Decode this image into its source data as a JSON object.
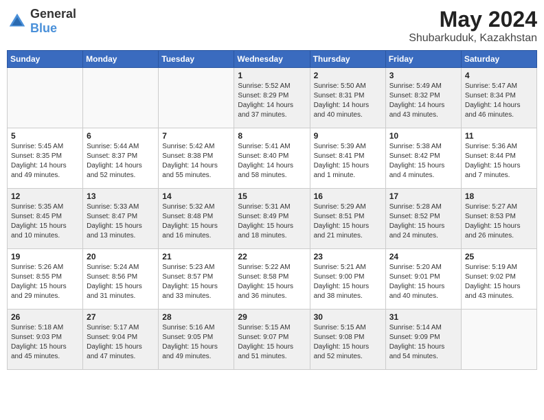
{
  "header": {
    "logo_general": "General",
    "logo_blue": "Blue",
    "month_year": "May 2024",
    "location": "Shubarkuduk, Kazakhstan"
  },
  "days_of_week": [
    "Sunday",
    "Monday",
    "Tuesday",
    "Wednesday",
    "Thursday",
    "Friday",
    "Saturday"
  ],
  "weeks": [
    [
      {
        "day": "",
        "info": ""
      },
      {
        "day": "",
        "info": ""
      },
      {
        "day": "",
        "info": ""
      },
      {
        "day": "1",
        "info": "Sunrise: 5:52 AM\nSunset: 8:29 PM\nDaylight: 14 hours\nand 37 minutes."
      },
      {
        "day": "2",
        "info": "Sunrise: 5:50 AM\nSunset: 8:31 PM\nDaylight: 14 hours\nand 40 minutes."
      },
      {
        "day": "3",
        "info": "Sunrise: 5:49 AM\nSunset: 8:32 PM\nDaylight: 14 hours\nand 43 minutes."
      },
      {
        "day": "4",
        "info": "Sunrise: 5:47 AM\nSunset: 8:34 PM\nDaylight: 14 hours\nand 46 minutes."
      }
    ],
    [
      {
        "day": "5",
        "info": "Sunrise: 5:45 AM\nSunset: 8:35 PM\nDaylight: 14 hours\nand 49 minutes."
      },
      {
        "day": "6",
        "info": "Sunrise: 5:44 AM\nSunset: 8:37 PM\nDaylight: 14 hours\nand 52 minutes."
      },
      {
        "day": "7",
        "info": "Sunrise: 5:42 AM\nSunset: 8:38 PM\nDaylight: 14 hours\nand 55 minutes."
      },
      {
        "day": "8",
        "info": "Sunrise: 5:41 AM\nSunset: 8:40 PM\nDaylight: 14 hours\nand 58 minutes."
      },
      {
        "day": "9",
        "info": "Sunrise: 5:39 AM\nSunset: 8:41 PM\nDaylight: 15 hours\nand 1 minute."
      },
      {
        "day": "10",
        "info": "Sunrise: 5:38 AM\nSunset: 8:42 PM\nDaylight: 15 hours\nand 4 minutes."
      },
      {
        "day": "11",
        "info": "Sunrise: 5:36 AM\nSunset: 8:44 PM\nDaylight: 15 hours\nand 7 minutes."
      }
    ],
    [
      {
        "day": "12",
        "info": "Sunrise: 5:35 AM\nSunset: 8:45 PM\nDaylight: 15 hours\nand 10 minutes."
      },
      {
        "day": "13",
        "info": "Sunrise: 5:33 AM\nSunset: 8:47 PM\nDaylight: 15 hours\nand 13 minutes."
      },
      {
        "day": "14",
        "info": "Sunrise: 5:32 AM\nSunset: 8:48 PM\nDaylight: 15 hours\nand 16 minutes."
      },
      {
        "day": "15",
        "info": "Sunrise: 5:31 AM\nSunset: 8:49 PM\nDaylight: 15 hours\nand 18 minutes."
      },
      {
        "day": "16",
        "info": "Sunrise: 5:29 AM\nSunset: 8:51 PM\nDaylight: 15 hours\nand 21 minutes."
      },
      {
        "day": "17",
        "info": "Sunrise: 5:28 AM\nSunset: 8:52 PM\nDaylight: 15 hours\nand 24 minutes."
      },
      {
        "day": "18",
        "info": "Sunrise: 5:27 AM\nSunset: 8:53 PM\nDaylight: 15 hours\nand 26 minutes."
      }
    ],
    [
      {
        "day": "19",
        "info": "Sunrise: 5:26 AM\nSunset: 8:55 PM\nDaylight: 15 hours\nand 29 minutes."
      },
      {
        "day": "20",
        "info": "Sunrise: 5:24 AM\nSunset: 8:56 PM\nDaylight: 15 hours\nand 31 minutes."
      },
      {
        "day": "21",
        "info": "Sunrise: 5:23 AM\nSunset: 8:57 PM\nDaylight: 15 hours\nand 33 minutes."
      },
      {
        "day": "22",
        "info": "Sunrise: 5:22 AM\nSunset: 8:58 PM\nDaylight: 15 hours\nand 36 minutes."
      },
      {
        "day": "23",
        "info": "Sunrise: 5:21 AM\nSunset: 9:00 PM\nDaylight: 15 hours\nand 38 minutes."
      },
      {
        "day": "24",
        "info": "Sunrise: 5:20 AM\nSunset: 9:01 PM\nDaylight: 15 hours\nand 40 minutes."
      },
      {
        "day": "25",
        "info": "Sunrise: 5:19 AM\nSunset: 9:02 PM\nDaylight: 15 hours\nand 43 minutes."
      }
    ],
    [
      {
        "day": "26",
        "info": "Sunrise: 5:18 AM\nSunset: 9:03 PM\nDaylight: 15 hours\nand 45 minutes."
      },
      {
        "day": "27",
        "info": "Sunrise: 5:17 AM\nSunset: 9:04 PM\nDaylight: 15 hours\nand 47 minutes."
      },
      {
        "day": "28",
        "info": "Sunrise: 5:16 AM\nSunset: 9:05 PM\nDaylight: 15 hours\nand 49 minutes."
      },
      {
        "day": "29",
        "info": "Sunrise: 5:15 AM\nSunset: 9:07 PM\nDaylight: 15 hours\nand 51 minutes."
      },
      {
        "day": "30",
        "info": "Sunrise: 5:15 AM\nSunset: 9:08 PM\nDaylight: 15 hours\nand 52 minutes."
      },
      {
        "day": "31",
        "info": "Sunrise: 5:14 AM\nSunset: 9:09 PM\nDaylight: 15 hours\nand 54 minutes."
      },
      {
        "day": "",
        "info": ""
      }
    ]
  ]
}
